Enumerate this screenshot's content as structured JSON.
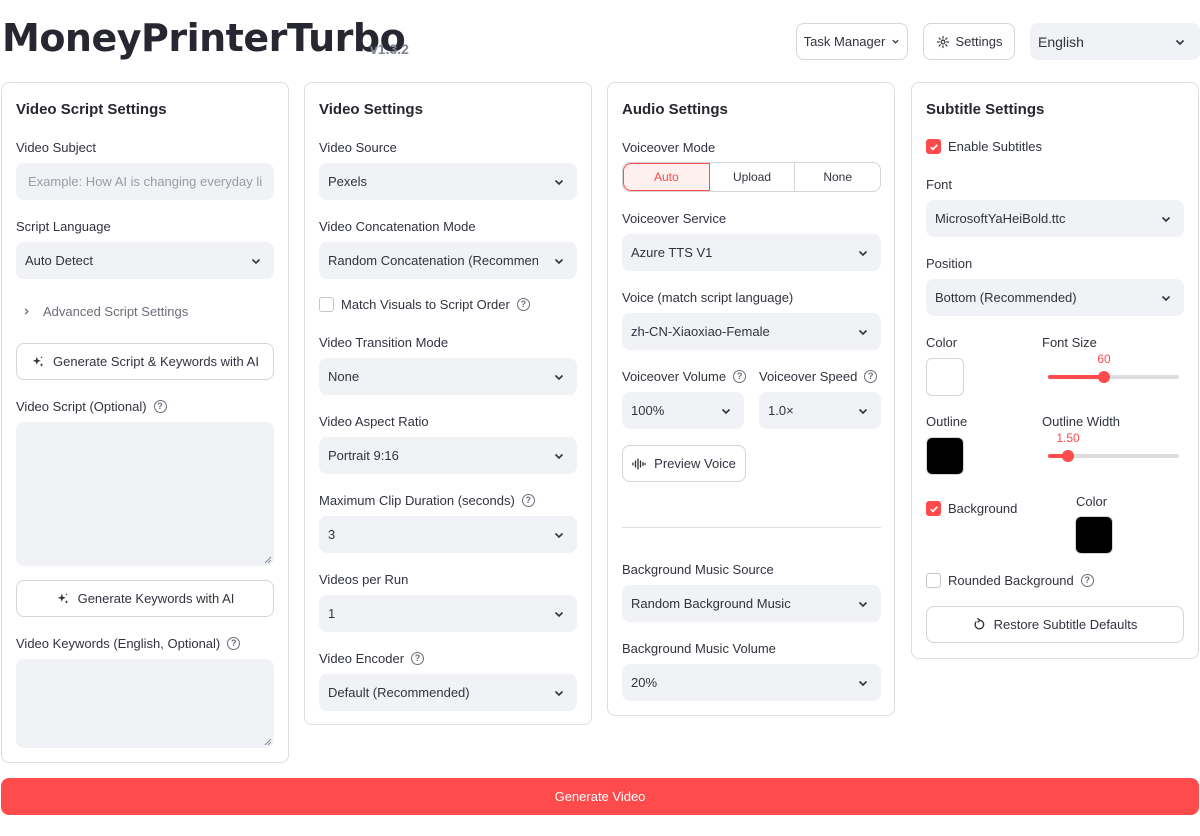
{
  "header": {
    "title": "MoneyPrinterTurbo",
    "version": "v1.3.2",
    "task_manager_label": "Task Manager",
    "settings_label": "Settings",
    "language_value": "English"
  },
  "script_panel": {
    "title": "Video Script Settings",
    "subject_label": "Video Subject",
    "subject_placeholder": "Example: How AI is changing everyday life",
    "language_label": "Script Language",
    "language_value": "Auto Detect",
    "advanced_label": "Advanced Script Settings",
    "generate_script_button": "Generate Script & Keywords with AI",
    "script_label": "Video Script (Optional)",
    "generate_keywords_button": "Generate Keywords with AI",
    "keywords_label": "Video Keywords (English, Optional)"
  },
  "video_panel": {
    "title": "Video Settings",
    "source_label": "Video Source",
    "source_value": "Pexels",
    "concat_label": "Video Concatenation Mode",
    "concat_value": "Random Concatenation (Recommended)",
    "match_visuals_label": "Match Visuals to Script Order",
    "match_visuals_checked": false,
    "transition_label": "Video Transition Mode",
    "transition_value": "None",
    "aspect_label": "Video Aspect Ratio",
    "aspect_value": "Portrait 9:16",
    "clip_duration_label": "Maximum Clip Duration (seconds)",
    "clip_duration_value": "3",
    "per_run_label": "Videos per Run",
    "per_run_value": "1",
    "encoder_label": "Video Encoder",
    "encoder_value": "Default (Recommended)"
  },
  "audio_panel": {
    "title": "Audio Settings",
    "voiceover_mode_label": "Voiceover Mode",
    "voiceover_modes": [
      "Auto",
      "Upload",
      "None"
    ],
    "voiceover_mode_selected": "Auto",
    "service_label": "Voiceover Service",
    "service_value": "Azure TTS V1",
    "voice_label": "Voice (match script language)",
    "voice_value": "zh-CN-Xiaoxiao-Female",
    "volume_label": "Voiceover Volume",
    "volume_value": "100%",
    "speed_label": "Voiceover Speed",
    "speed_value": "1.0×",
    "preview_button": "Preview Voice",
    "bgm_source_label": "Background Music Source",
    "bgm_source_value": "Random Background Music",
    "bgm_volume_label": "Background Music Volume",
    "bgm_volume_value": "20%"
  },
  "subtitle_panel": {
    "title": "Subtitle Settings",
    "enable_label": "Enable Subtitles",
    "enable_checked": true,
    "font_label": "Font",
    "font_value": "MicrosoftYaHeiBold.ttc",
    "position_label": "Position",
    "position_value": "Bottom (Recommended)",
    "color_label": "Color",
    "color_value": "#ffffff",
    "font_size_label": "Font Size",
    "font_size_value": "60",
    "font_size_fraction": 0.43,
    "outline_label": "Outline",
    "outline_color": "#000000",
    "outline_width_label": "Outline Width",
    "outline_width_value": "1.50",
    "outline_width_fraction": 0.15,
    "background_label": "Background",
    "background_checked": true,
    "background_color_label": "Color",
    "background_color": "#000000",
    "rounded_label": "Rounded Background",
    "rounded_checked": false,
    "restore_button": "Restore Subtitle Defaults"
  },
  "footer": {
    "generate_button": "Generate Video"
  },
  "colors": {
    "accent": "#ff4b4b",
    "input_bg": "#f0f2f6"
  }
}
